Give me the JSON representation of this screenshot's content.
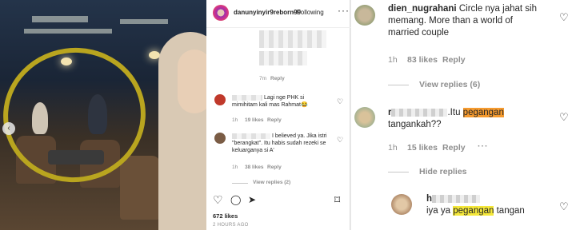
{
  "post": {
    "username": "danunyinyir9reborn99",
    "follow_label": "Following",
    "more_glyph": "···",
    "prev_glyph": "‹",
    "likes": "672 likes",
    "time_ago": "2 HOURS AGO",
    "actions": {
      "like": "♡",
      "comment": "◯",
      "share": "➤",
      "save": "⌑"
    }
  },
  "mid_comments": [
    {
      "text": "",
      "time": "7m",
      "reply": "Reply"
    },
    {
      "text": "Lagi nge PHK si mimihitam kali mas Rahmat😂",
      "time": "1h",
      "likes": "19 likes",
      "reply": "Reply"
    },
    {
      "text": "I believed ya. Jika istri \"berangkat\". Itu habis sudah rezeki se keluarganya si A'",
      "time": "1h",
      "likes": "38 likes",
      "reply": "Reply",
      "view_replies": "View replies (2)"
    }
  ],
  "right_comments": [
    {
      "name": "dien_nugrahani",
      "text_lines": [
        "Circle nya jahat sih",
        "memang. More than a world of",
        "married couple"
      ],
      "time": "1h",
      "likes": "83 likes",
      "reply": "Reply",
      "view_replies": "View replies (6)"
    },
    {
      "name_prefix": "r",
      "text_before": ".Itu ",
      "highlight": "pegangan",
      "text_after": "tangankah??",
      "time": "1h",
      "likes": "15 likes",
      "reply": "Reply",
      "more": "···",
      "hide_replies": "Hide replies"
    },
    {
      "name_prefix": "h",
      "text_before": "iya ya ",
      "highlight": "pegangan",
      "text_after": " tangan"
    }
  ],
  "colors": {
    "orange_highlight": "#f59a2e",
    "yellow_highlight": "#f5e83a",
    "circle": "#b9a51f"
  }
}
